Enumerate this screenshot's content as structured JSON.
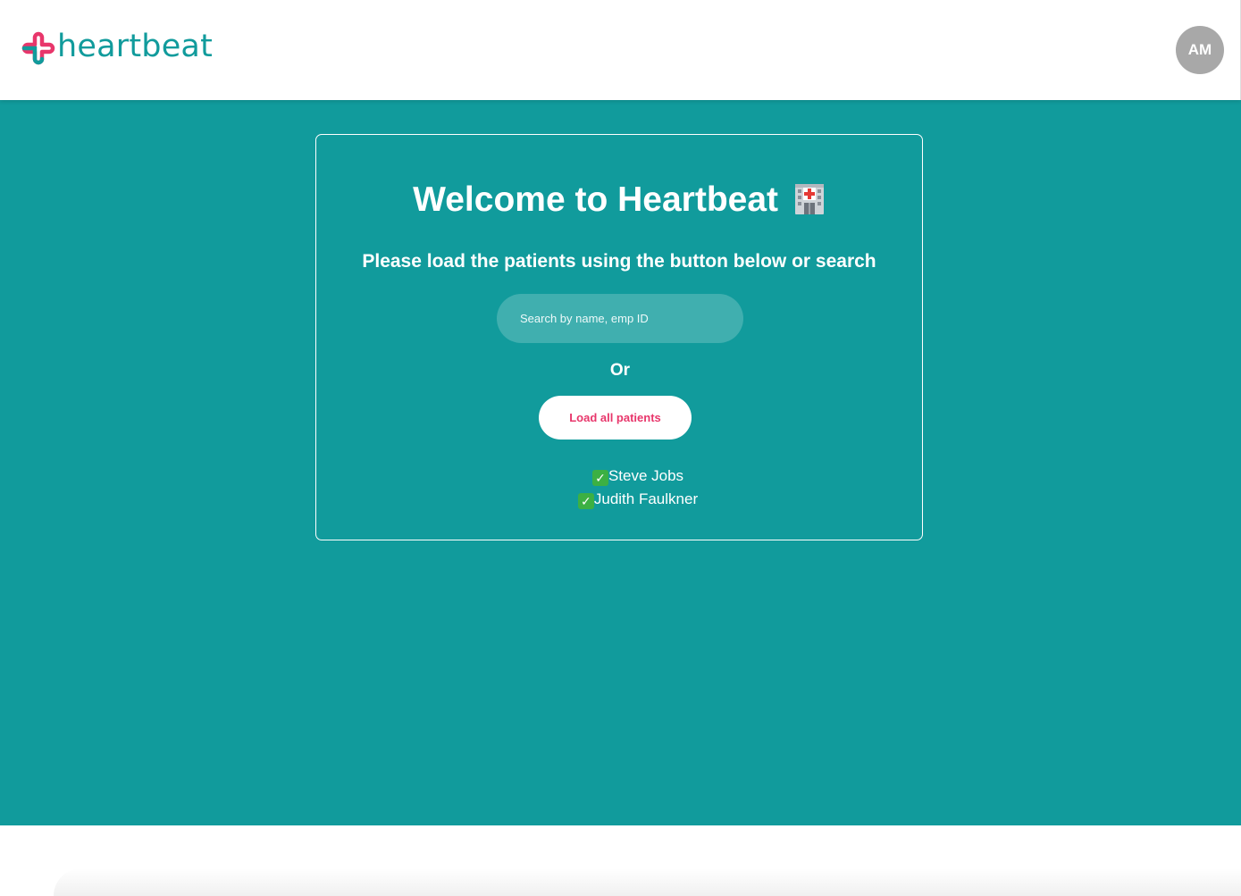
{
  "header": {
    "logo_text": "heartbeat",
    "avatar_initials": "AM"
  },
  "colors": {
    "brand_teal": "#119b9c",
    "brand_pink": "#e8366b",
    "avatar_gray": "#a8a8a8"
  },
  "welcome": {
    "title": "Welcome to Heartbeat",
    "title_icon": "hospital-icon",
    "subtitle": "Please load the patients using the button below or search",
    "search_placeholder": "Search by name, emp ID",
    "search_value": "",
    "or_text": "Or",
    "load_button_label": "Load all patients"
  },
  "patients": [
    {
      "name": "Steve Jobs",
      "icon": "check-mark-icon"
    },
    {
      "name": "Judith Faulkner",
      "icon": "check-mark-icon"
    }
  ]
}
